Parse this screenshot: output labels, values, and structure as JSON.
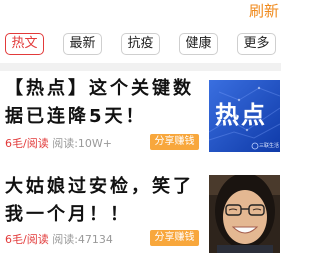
{
  "header": {
    "refresh_label": "刷新"
  },
  "tabs": [
    {
      "label": "热文",
      "active": true
    },
    {
      "label": "最新",
      "active": false
    },
    {
      "label": "抗疫",
      "active": false
    },
    {
      "label": "健康",
      "active": false
    },
    {
      "label": "更多",
      "active": false
    }
  ],
  "articles": [
    {
      "title": "【热点】这个关键数据已连降5天！",
      "price": "6毛/阅读",
      "reads": "阅读:10W+",
      "share_label": "分享赚钱",
      "thumb": {
        "text": "热点",
        "caption": "三联生活",
        "bg": "#1f54c9"
      }
    },
    {
      "title": "大姑娘过安检，笑了我一个月！！",
      "price": "6毛/阅读",
      "reads": "阅读:47134",
      "share_label": "分享赚钱",
      "thumb": {
        "bg": "#3a2d22"
      }
    }
  ],
  "colors": {
    "accent": "#e23a3a",
    "orange": "#f08a1c",
    "share_button": "#f8a73c"
  }
}
